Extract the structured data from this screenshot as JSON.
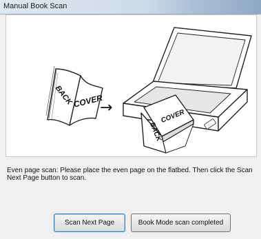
{
  "window": {
    "title": "Manual Book Scan"
  },
  "illustration": {
    "book_back_label": "BACK",
    "book_cover_label": "COVER",
    "arrow_glyph": "→",
    "scanner_book_cover_label": "COVER",
    "scanner_book_back_label": "BACK"
  },
  "message": "Even page scan: Please place the even page on the flatbed. Then click the Scan Next Page button to scan.",
  "buttons": {
    "scan_next_page": "Scan Next Page",
    "book_mode_completed": "Book Mode scan completed"
  }
}
